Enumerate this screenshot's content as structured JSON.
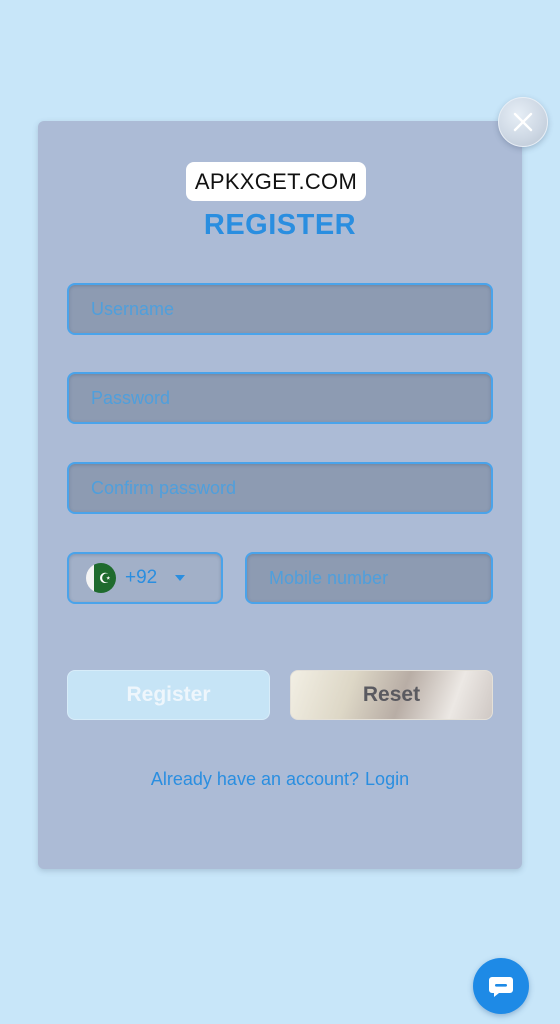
{
  "watermark": "APKXGET.COM",
  "title": "REGISTER",
  "fields": {
    "username_placeholder": "Username",
    "password_placeholder": "Password",
    "confirm_placeholder": "Confirm password",
    "mobile_placeholder": "Mobile number"
  },
  "country": {
    "code": "+92",
    "flag_icon": "pakistan-flag-icon",
    "flag_symbol": "☪"
  },
  "buttons": {
    "register": "Register",
    "reset": "Reset"
  },
  "login": {
    "prompt": "Already have an account?",
    "link": "Login"
  },
  "icons": {
    "close": "close-icon",
    "chat": "chat-bubble-icon",
    "dropdown": "caret-down-icon"
  },
  "colors": {
    "page_background": "#c8e6f9",
    "modal_background": "#acbbd6",
    "accent_blue": "#2a8ee0",
    "input_background": "#8d9bb2"
  }
}
